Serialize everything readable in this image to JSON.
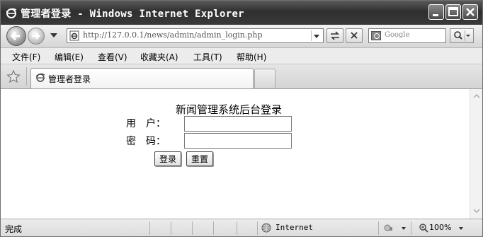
{
  "window": {
    "title": "管理者登录 - Windows Internet Explorer"
  },
  "nav": {
    "address": "http://127.0.0.1/news/admin/admin_login.php",
    "search_placeholder": "Google"
  },
  "menu": [
    "文件(F)",
    "编辑(E)",
    "查看(V)",
    "收藏夹(A)",
    "工具(T)",
    "帮助(H)"
  ],
  "tab": {
    "title": "管理者登录"
  },
  "page": {
    "heading": "新闻管理系统后台登录",
    "username_label": "用　户：",
    "password_label": "密　码：",
    "username_value": "",
    "password_value": "",
    "login_button": "登录",
    "reset_button": "重置"
  },
  "status": {
    "text": "完成",
    "zone": "Internet",
    "zoom": "100%"
  }
}
